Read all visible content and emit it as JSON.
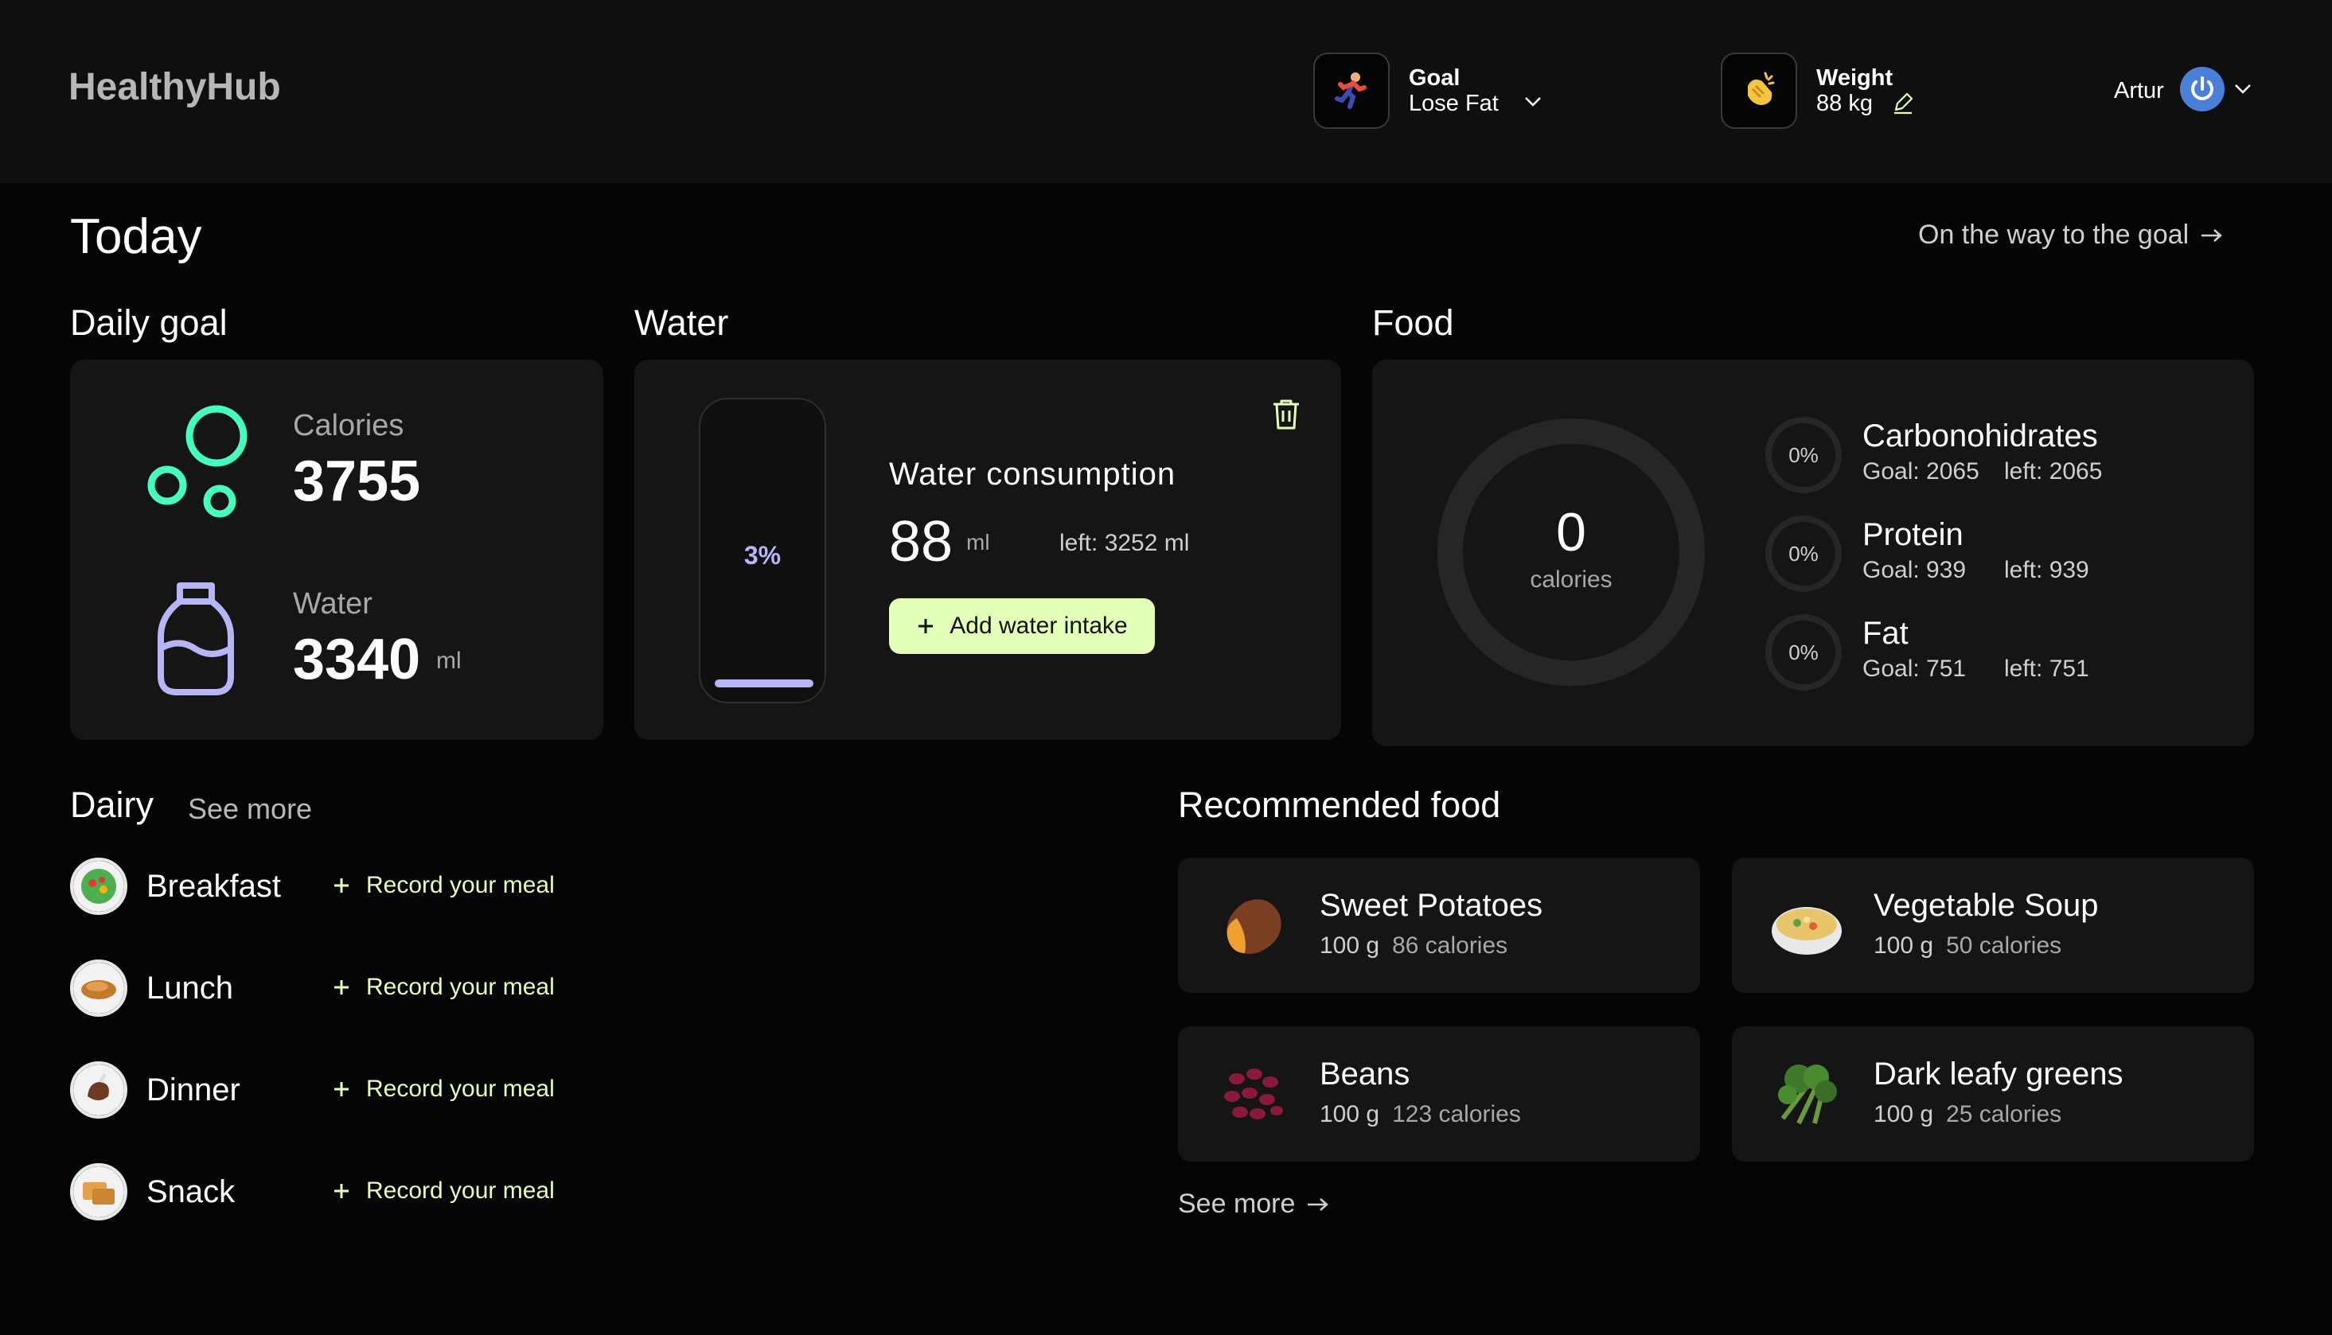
{
  "header": {
    "logo": "HealthyHub",
    "goal": {
      "title": "Goal",
      "value": "Lose Fat",
      "icon": "runner-icon"
    },
    "weight": {
      "title": "Weight",
      "value": "88 kg",
      "icon": "clap-icon"
    },
    "user": {
      "name": "Artur"
    }
  },
  "page": {
    "title": "Today",
    "goal_link": "On the way to the goal"
  },
  "daily_goal": {
    "title": "Daily goal",
    "calories_label": "Calories",
    "calories_value": "3755",
    "water_label": "Water",
    "water_value": "3340",
    "water_unit": "ml"
  },
  "water": {
    "title": "Water",
    "percent": "3%",
    "fill_fraction": 0.03,
    "consumption_title": "Water consumption",
    "consumed": "88",
    "unit": "ml",
    "left": "left: 3252 ml",
    "add_button": "Add water intake"
  },
  "food": {
    "title": "Food",
    "calories_value": "0",
    "calories_label": "calories",
    "macros": [
      {
        "pct": "0%",
        "name": "Carbonohidrates",
        "goal": "Goal: 2065",
        "left": "left: 2065"
      },
      {
        "pct": "0%",
        "name": "Protein",
        "goal": "Goal: 939",
        "left": "left: 939"
      },
      {
        "pct": "0%",
        "name": "Fat",
        "goal": "Goal: 751",
        "left": "left: 751"
      }
    ]
  },
  "dairy": {
    "title": "Dairy",
    "see_more": "See more",
    "meals": [
      {
        "name": "Breakfast",
        "action": "Record your meal"
      },
      {
        "name": "Lunch",
        "action": "Record your meal"
      },
      {
        "name": "Dinner",
        "action": "Record your meal"
      },
      {
        "name": "Snack",
        "action": "Record your meal"
      }
    ]
  },
  "recommended": {
    "title": "Recommended food",
    "see_more": "See more",
    "items": [
      {
        "name": "Sweet Potatoes",
        "amount": "100 g",
        "calories": "86 calories"
      },
      {
        "name": "Vegetable Soup",
        "amount": "100 g",
        "calories": "50 calories"
      },
      {
        "name": "Beans",
        "amount": "100 g",
        "calories": "123 calories"
      },
      {
        "name": "Dark leafy greens",
        "amount": "100 g",
        "calories": "25 calories"
      }
    ]
  },
  "colors": {
    "accent_lime": "#e4ffb8",
    "accent_mint": "#45ffbc",
    "accent_lavender": "#b6b5f5",
    "card_bg": "#151515",
    "page_bg": "#050505"
  }
}
